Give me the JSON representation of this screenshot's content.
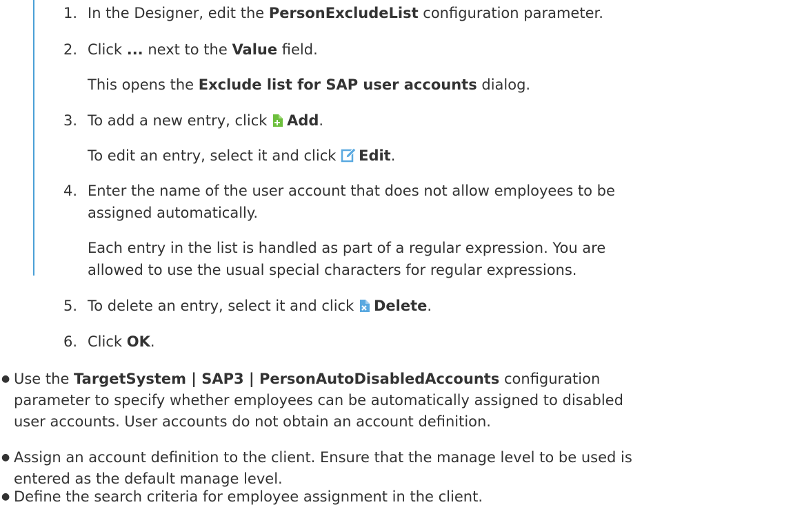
{
  "steps": [
    {
      "num": "1.",
      "pre": "In the Designer, edit the ",
      "bold": "PersonExcludeList",
      "post": " configuration parameter."
    },
    {
      "num": "2.",
      "pre": "Click ",
      "bold": "...",
      "mid": " next to the ",
      "bold2": "Value",
      "post": " field.",
      "note_pre": "This opens the ",
      "note_bold": "Exclude list for SAP user accounts",
      "note_post": " dialog."
    },
    {
      "num": "3.",
      "pre": "To add a new entry, click ",
      "icon": "add-icon",
      "bold": "Add",
      "post": ".",
      "note_pre": "To edit an entry, select it and click ",
      "note_icon": "edit-icon",
      "note_bold": "Edit",
      "note_post": "."
    },
    {
      "num": "4.",
      "line1": "Enter the name of the user account that does not allow employees to be",
      "line2": "assigned automatically.",
      "note1": "Each entry in the list is handled as part of a regular expression. You are",
      "note2": "allowed to use the usual special characters for regular expressions."
    },
    {
      "num": "5.",
      "pre": "To delete an entry, select it and click ",
      "icon": "delete-icon",
      "bold": "Delete",
      "post": "."
    },
    {
      "num": "6.",
      "pre": "Click ",
      "bold": "OK",
      "post": "."
    }
  ],
  "bullets": [
    {
      "pre": "Use the ",
      "bold": "TargetSystem | SAP3 | PersonAutoDisabledAccounts",
      "line1_post": " configuration",
      "line2": "parameter to specify whether employees can be automatically assigned to disabled",
      "line3": "user accounts. User accounts do not obtain an account definition."
    },
    {
      "line1": "Assign an account definition to the client. Ensure that the manage level to be used is",
      "line2": "entered as the default manage level."
    },
    {
      "line1": "Define the search criteria for employee assignment in the client."
    }
  ],
  "bullet_char": "●",
  "colors": {
    "accent_bar": "#4a9fd6",
    "add_icon": "#6cbf3c",
    "edit_icon": "#5aa9e0",
    "delete_icon": "#5aa9e0"
  }
}
